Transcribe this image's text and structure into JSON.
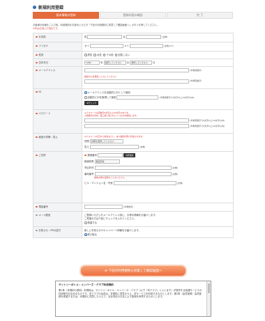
{
  "page": {
    "title": "新規利用登録"
  },
  "steps": [
    {
      "label": "基本情報の登録",
      "active": true
    },
    {
      "label": "登録内容の確認",
      "active": false
    },
    {
      "label": "完 了",
      "active": false
    }
  ],
  "intro": {
    "line1": "お客様の情報をご入力後、利用規約をお読みいただき「下記の利用規約に同意して確認画面へ」ボタンを押してください。",
    "line2": "※印は必須入力項目です。"
  },
  "form": {
    "name": {
      "label": "お名前",
      "sei": "姓",
      "mei": "名",
      "note": "(全角)"
    },
    "kana": {
      "label": "フリガナ",
      "sei": "セイ",
      "mei": "メイ",
      "note": "(全角カナ)"
    },
    "gender": {
      "label": "性別",
      "options": [
        "男性",
        "女性",
        "その他",
        "回答しない"
      ]
    },
    "birth": {
      "label": "生年月日",
      "year": "1980",
      "year_unit": "年",
      "month": "選択してください",
      "month_unit": "月",
      "day": "選択してください",
      "day_unit": "日"
    },
    "email": {
      "label": "メールアドレス",
      "note1": "(半角英数字)",
      "warn": "確認のため再度ご入力してください",
      "note2": "(半角英数字)"
    },
    "login_id": {
      "label": "ID",
      "opt1": "メールアドレスを自動的にIDとして使用",
      "opt2": "自動的にIDを取得して使用",
      "opt2_note": "(半角英数字で6文字以上16文字以内)",
      "check": "IDチェック"
    },
    "password": {
      "label": "パスワード",
      "warn1": "※パスワードは英数字6文字以上16文字以内です。",
      "warn2": "※英数字を含め、第三者に知られにくいものを推奨します。",
      "note1": "(半角英数字で6文字以上16文字以内)",
      "note2": "(半角英数字で6文字以上16文字以内)"
    },
    "secret": {
      "label": "秘密の質問・答え",
      "warn": "※パスワードを忘れた場合などに、本人確認の際に利用されます。",
      "q_label": "質問",
      "q_value": "質問を選択してください",
      "a_label": "答え",
      "a_note": "(全角)"
    },
    "address": {
      "label": "ご住所",
      "zip_label": "郵便番号",
      "zip_btn": "住所検索",
      "pref_label": "都道府県",
      "pref_value": "都道府県",
      "city_label": "市区町村",
      "city_note": "(全角)",
      "street_label": "番地番号",
      "street_note": "(全角)",
      "street_warn": "番地以降の住所をご入力ください。",
      "bldg_label": "ビル・マンション名・号室",
      "bldg_note": "(全角)"
    },
    "phone": {
      "label": "電話番号",
      "note": "(半角数字)"
    },
    "news": {
      "label": "メール配信",
      "text1": "ご登録いただいたメールアドレス宛に、お得な情報をお届けします。",
      "text2": "ご希望の方は下記にチェックを入れてください。",
      "check": "希望する"
    },
    "mailmag": {
      "label": "お知らせ・PRの送付",
      "text": "新しいお知らせやキャンペーン情報をお届けします。",
      "yes": "受け取る"
    }
  },
  "cta": {
    "label": "≫ 下記の利用規約に同意して確認画面へ"
  },
  "terms": {
    "title": "サントリーボトル・メンバーズ・クラブ利用規約",
    "body": "第1条（本規約の適用）本規約は、サントリーボトル・メンバーズ・クラブ（以下「本クラブ」といいます）が提供する各種サービスの利用条件を定めるものです。本クラブの会員は、本規約に同意のうえ、本サービスを利用するものとします。第2条（会員登録）会員登録を希望する方は、本規約に同意したうえで、当社所定の方法により登録を申請するものとします。"
  }
}
